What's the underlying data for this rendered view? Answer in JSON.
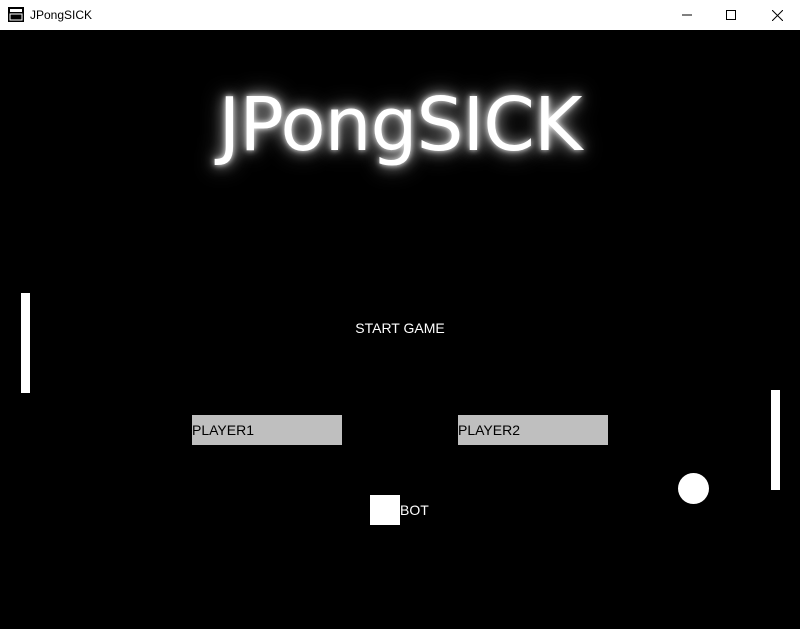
{
  "window": {
    "title": "JPongSICK",
    "icon": "app-window-icon",
    "controls": {
      "minimize_icon": "minimize-icon",
      "maximize_icon": "maximize-icon",
      "close_icon": "close-icon"
    }
  },
  "game": {
    "logo": "JPongSICK",
    "menu": {
      "start_label": "START GAME",
      "player1_label": "PLAYER1",
      "player2_label": "PLAYER2",
      "bot_label": "BOT"
    },
    "colors": {
      "background": "#000000",
      "foreground": "#ffffff",
      "button_fill": "#bfbfbf"
    }
  }
}
